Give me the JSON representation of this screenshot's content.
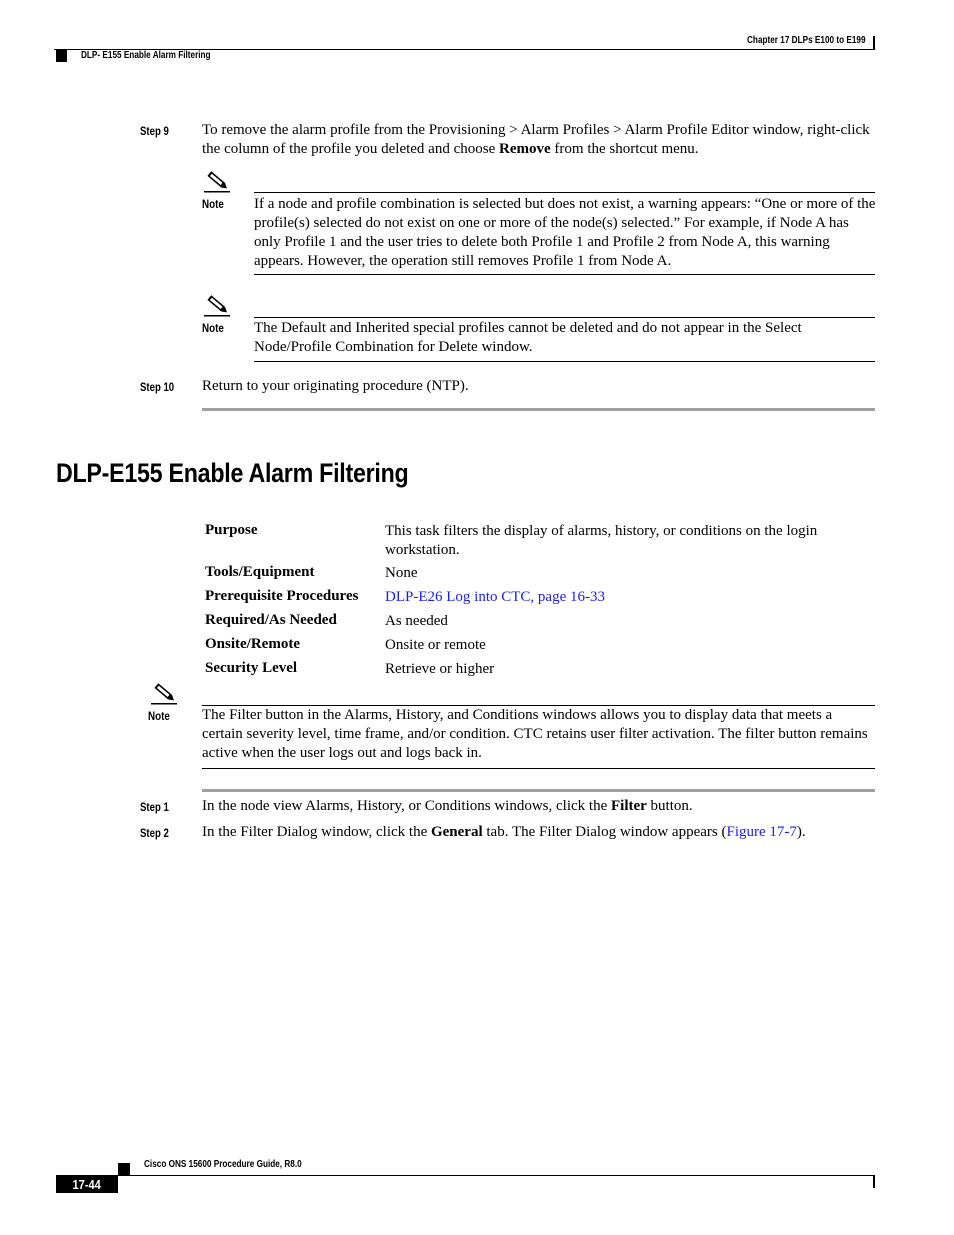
{
  "header": {
    "chapter": "Chapter 17 DLPs E100 to E199",
    "section": "DLP- E155 Enable Alarm Filtering"
  },
  "previous_procedure": {
    "step9": {
      "label": "Step 9",
      "text_before": "To remove the alarm profile from the Provisioning > Alarm Profiles > Alarm Profile Editor window, right-click the column of the profile you deleted and choose ",
      "bold": "Remove",
      "text_after": " from the shortcut menu."
    },
    "notes": [
      {
        "label": "Note",
        "icon": "pencil-icon",
        "text": "If a node and profile combination is selected but does not exist, a warning appears: “One or more of the profile(s) selected do not exist on one or more of the node(s) selected.” For example, if Node A has only Profile 1 and the user tries to delete both Profile 1 and Profile 2 from Node A, this warning appears. However, the operation still removes Profile 1 from Node A."
      },
      {
        "label": "Note",
        "icon": "pencil-icon",
        "text": "The Default and Inherited special profiles cannot be deleted and do not appear in the Select Node/Profile Combination for Delete window."
      }
    ],
    "step10": {
      "label": "Step 10",
      "text": "Return to your originating procedure (NTP)."
    }
  },
  "section": {
    "title": "DLP-E155 Enable Alarm Filtering",
    "table": [
      {
        "label": "Purpose",
        "value": "This task filters the display of alarms, history, or conditions on the login workstation.",
        "is_link": false
      },
      {
        "label": "Tools/Equipment",
        "value": "None",
        "is_link": false
      },
      {
        "label": "Prerequisite Procedures",
        "value": "DLP-E26 Log into CTC, page 16-33",
        "is_link": true
      },
      {
        "label": "Required/As Needed",
        "value": "As needed",
        "is_link": false
      },
      {
        "label": "Onsite/Remote",
        "value": "Onsite or remote",
        "is_link": false
      },
      {
        "label": "Security Level",
        "value": "Retrieve or higher",
        "is_link": false
      }
    ],
    "note": {
      "label": "Note",
      "icon": "pencil-icon",
      "text": "The Filter button in the Alarms, History, and Conditions windows allows you to display data that meets a certain severity level, time frame, and/or condition. CTC retains user filter activation. The filter button remains active when the user logs out and logs back in."
    },
    "steps": [
      {
        "label": "Step 1",
        "text_before": "In the node view Alarms, History, or Conditions windows, click the ",
        "bold": "Filter",
        "text_after": " button."
      },
      {
        "label": "Step 2",
        "text_before": "In the Filter Dialog window, click the ",
        "bold": "General",
        "text_middle": " tab. The Filter Dialog window appears (",
        "link": "Figure 17-7",
        "text_after": ")."
      }
    ]
  },
  "footer": {
    "guide": "Cisco ONS 15600 Procedure Guide, R8.0",
    "page": "17-44"
  },
  "colors": {
    "link": "#1a1aff",
    "rule_gray": "#a0a0a0"
  }
}
